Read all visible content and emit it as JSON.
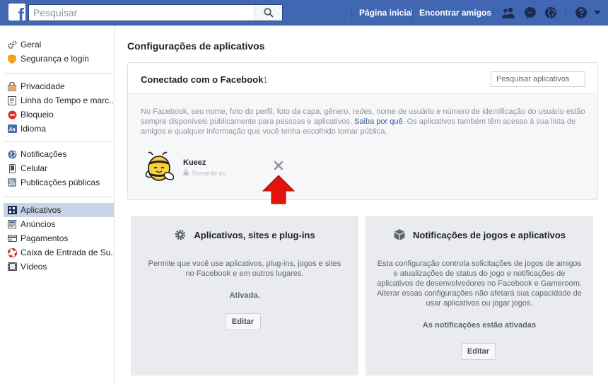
{
  "header": {
    "logo_letter": "f",
    "search_placeholder": "Pesquisar",
    "nav_home": "Página inicial",
    "nav_find_friends": "Encontrar amigos",
    "bar_color": "#4267b2"
  },
  "sidebar": {
    "groups": [
      {
        "items": [
          {
            "label": "Geral",
            "icon": "gear-icon"
          },
          {
            "label": "Segurança e login",
            "icon": "shield-icon"
          }
        ]
      },
      {
        "items": [
          {
            "label": "Privacidade",
            "icon": "lock-icon"
          },
          {
            "label": "Linha do Tempo e marc...",
            "icon": "timeline-icon"
          },
          {
            "label": "Bloqueio",
            "icon": "block-icon"
          },
          {
            "label": "Idioma",
            "icon": "language-icon"
          }
        ]
      },
      {
        "items": [
          {
            "label": "Notificações",
            "icon": "globe-icon"
          },
          {
            "label": "Celular",
            "icon": "phone-icon"
          },
          {
            "label": "Publicações públicas",
            "icon": "rss-icon"
          }
        ]
      },
      {
        "items": [
          {
            "label": "Aplicativos",
            "icon": "apps-icon",
            "active": true
          },
          {
            "label": "Anúncios",
            "icon": "ads-icon"
          },
          {
            "label": "Pagamentos",
            "icon": "card-icon"
          },
          {
            "label": "Caixa de Entrada de Su...",
            "icon": "lifebuoy-icon"
          },
          {
            "label": "Vídeos",
            "icon": "film-icon"
          }
        ]
      }
    ]
  },
  "main": {
    "title": "Configurações de aplicativos",
    "connected": {
      "title": "Conectado com o Facebook",
      "count": "1",
      "search_placeholder": "Pesquisar aplicativos",
      "desc_before": "No Facebook, seu nome, foto do perfil, foto da capa, gênero, redes, nome de usuário e número de identificação do usuário estão sempre disponíveis publicamente para pessoas e aplicativos. ",
      "desc_link": "Saiba por quê",
      "desc_after": ". Os aplicativos também têm acesso à sua lista de amigos e qualquer informação que você tenha escolhido tornar pública.",
      "apps": [
        {
          "name": "Kueez",
          "privacy": "Somente eu",
          "icon": "bee-app-icon"
        }
      ]
    },
    "cards": [
      {
        "title": "Aplicativos, sites e plug-ins",
        "icon": "gear-icon",
        "description": "Permite que você use aplicativos, plug-ins, jogos e sites no Facebook e em outros lugares.",
        "status": "Ativada.",
        "button": "Editar"
      },
      {
        "title": "Notificações de jogos e aplicativos",
        "icon": "cube-icon",
        "description": "Esta configuração controla solicitações de jogos de amigos e atualizações de status do jogo e notificações de aplicativos de desenvolvedores no Facebook e Gameroom. Alterar essas configurações não afetará sua capacidade de usar aplicativos ou jogar jogos.",
        "status": "As notificações estão ativadas",
        "button": "Editar"
      }
    ]
  }
}
